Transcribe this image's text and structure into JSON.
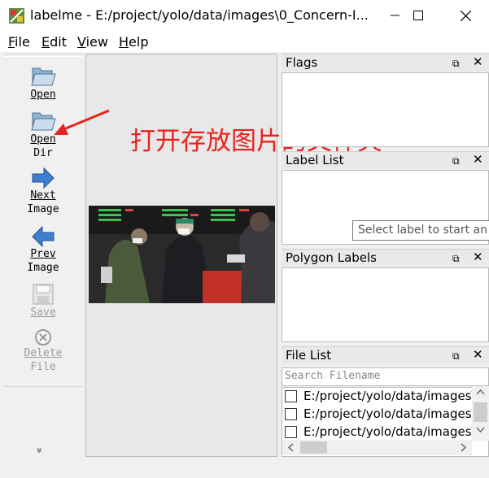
{
  "window": {
    "title": "labelme - E:/project/yolo/data/images\\0_Concern-I...",
    "minimize": "—",
    "maximize": "☐",
    "close": "✕"
  },
  "menu": [
    {
      "label": "File",
      "first": "F",
      "rest": "ile"
    },
    {
      "label": "Edit",
      "first": "E",
      "rest": "dit"
    },
    {
      "label": "View",
      "first": "V",
      "rest": "iew"
    },
    {
      "label": "Help",
      "first": "H",
      "rest": "elp"
    }
  ],
  "toolbar": {
    "open": "Open",
    "open_dir_1": "Open",
    "open_dir_2": "Dir",
    "next_1": "Next",
    "next_2": "Image",
    "prev_1": "Prev",
    "prev_2": "Image",
    "save": "Save",
    "delete_1": "Delete",
    "delete_2": "File",
    "more": "»"
  },
  "annotation": {
    "text": "打开存放图片的文件夹",
    "color": "#e8231f"
  },
  "docks": {
    "flags": "Flags",
    "label_list": "Label List",
    "polygon_labels": "Polygon Labels",
    "file_list": "File List",
    "float_icon": "⧉",
    "close_icon": "✕"
  },
  "tooltip": "Select label to start an",
  "file_list": {
    "placeholder": "Search Filename",
    "files": [
      "E:/project/yolo/data/images\\",
      "E:/project/yolo/data/images\\",
      "E:/project/yolo/data/images\\"
    ]
  }
}
